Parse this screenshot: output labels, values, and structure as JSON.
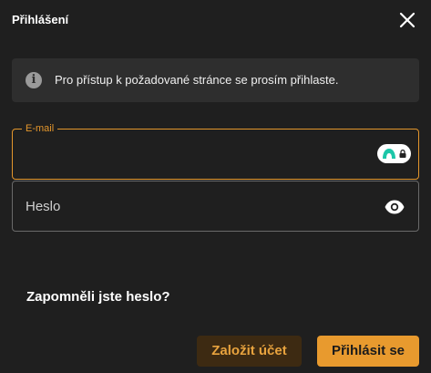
{
  "dialog": {
    "title": "Přihlášení",
    "close_icon": "close-icon"
  },
  "info": {
    "icon": "info-icon",
    "icon_glyph": "i",
    "text": "Pro přístup k požadované stránce se prosím přihlaste."
  },
  "email": {
    "label": "E-mail",
    "value": "",
    "badge_icon": "password-manager-icon"
  },
  "password": {
    "placeholder": "Heslo",
    "toggle_icon": "eye-icon"
  },
  "links": {
    "forgot": "Zapomněli jste heslo?"
  },
  "actions": {
    "create_account": "Založit účet",
    "sign_in": "Přihlásit se"
  },
  "colors": {
    "background": "#1f1f1f",
    "accent": "#e3962c",
    "primary_button": "#e89a2e",
    "secondary_button_bg": "#3d2a12",
    "secondary_button_text": "#e8a33e",
    "info_bg": "#2e2e2e"
  }
}
